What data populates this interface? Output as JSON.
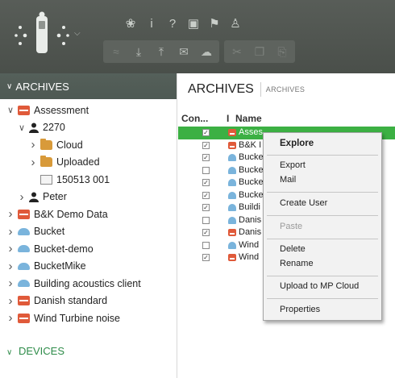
{
  "toolbar": {
    "logo": "meter-logo-icon",
    "row1": [
      {
        "name": "chat-icon",
        "glyph": "❀"
      },
      {
        "name": "info-icon",
        "glyph": "i"
      },
      {
        "name": "help-icon",
        "glyph": "?"
      },
      {
        "name": "report-icon",
        "glyph": "▣"
      },
      {
        "name": "pin-icon",
        "glyph": "⚑"
      },
      {
        "name": "users-icon",
        "glyph": "♙"
      }
    ],
    "row2": [
      {
        "name": "measure-icon",
        "glyph": "≈",
        "disabled": true
      },
      {
        "name": "download-icon",
        "glyph": "⤓",
        "disabled": false
      },
      {
        "name": "upload-icon",
        "glyph": "⤒",
        "disabled": false
      },
      {
        "name": "mail-icon",
        "glyph": "✉",
        "disabled": false
      },
      {
        "name": "cloud-icon",
        "glyph": "☁",
        "disabled": false
      },
      {
        "name": "cut-icon",
        "glyph": "✂",
        "disabled": true
      },
      {
        "name": "copy-icon",
        "glyph": "❐",
        "disabled": true
      },
      {
        "name": "paste-icon",
        "glyph": "⎘",
        "disabled": true
      }
    ]
  },
  "left": {
    "archives_header": "ARCHIVES",
    "devices_header": "DEVICES",
    "tree": [
      {
        "label": "Assessment",
        "icon": "archive",
        "indent": 0,
        "toggle": "expanded"
      },
      {
        "label": "2270",
        "icon": "person",
        "indent": 1,
        "toggle": "expanded"
      },
      {
        "label": "Cloud",
        "icon": "folder",
        "indent": 2,
        "toggle": "collapsed"
      },
      {
        "label": "Uploaded",
        "icon": "folder",
        "indent": 2,
        "toggle": "collapsed"
      },
      {
        "label": "150513 001",
        "icon": "file",
        "indent": 2,
        "toggle": "none"
      },
      {
        "label": "Peter",
        "icon": "person",
        "indent": 1,
        "toggle": "collapsed"
      },
      {
        "label": "B&K Demo Data",
        "icon": "archive",
        "indent": 0,
        "toggle": "collapsed"
      },
      {
        "label": "Bucket",
        "icon": "cloud",
        "indent": 0,
        "toggle": "collapsed"
      },
      {
        "label": "Bucket-demo",
        "icon": "cloud",
        "indent": 0,
        "toggle": "collapsed"
      },
      {
        "label": "BucketMike",
        "icon": "cloud",
        "indent": 0,
        "toggle": "collapsed"
      },
      {
        "label": "Building acoustics client",
        "icon": "cloud",
        "indent": 0,
        "toggle": "collapsed"
      },
      {
        "label": "Danish standard",
        "icon": "archive",
        "indent": 0,
        "toggle": "collapsed"
      },
      {
        "label": "Wind Turbine noise",
        "icon": "archive",
        "indent": 0,
        "toggle": "collapsed"
      }
    ]
  },
  "right": {
    "title": "ARCHIVES",
    "breadcrumb": "ARCHIVES",
    "columns": {
      "con": "Con...",
      "i": "I",
      "name": "Name"
    },
    "rows": [
      {
        "checked": true,
        "icon": "archive",
        "name": "Asses",
        "selected": true
      },
      {
        "checked": true,
        "icon": "archive",
        "name": "B&K I",
        "selected": false
      },
      {
        "checked": true,
        "icon": "cloud",
        "name": "Bucke",
        "selected": false
      },
      {
        "checked": false,
        "icon": "cloud",
        "name": "Bucke",
        "selected": false
      },
      {
        "checked": true,
        "icon": "cloud",
        "name": "Bucke",
        "selected": false
      },
      {
        "checked": true,
        "icon": "cloud",
        "name": "Bucke",
        "selected": false
      },
      {
        "checked": true,
        "icon": "cloud",
        "name": "Buildi",
        "selected": false
      },
      {
        "checked": false,
        "icon": "cloud",
        "name": "Danis",
        "selected": false
      },
      {
        "checked": true,
        "icon": "archive",
        "name": "Danis",
        "selected": false
      },
      {
        "checked": false,
        "icon": "cloud",
        "name": "Wind",
        "selected": false
      },
      {
        "checked": true,
        "icon": "archive",
        "name": "Wind",
        "selected": false
      }
    ]
  },
  "context_menu": {
    "items": [
      {
        "label": "Explore",
        "bold": true,
        "disabled": false
      },
      {
        "label": "Export",
        "bold": false,
        "disabled": false
      },
      {
        "label": "Mail",
        "bold": false,
        "disabled": false
      },
      {
        "label": "Create User",
        "bold": false,
        "disabled": false
      },
      {
        "label": "Paste",
        "bold": false,
        "disabled": true
      },
      {
        "label": "Delete",
        "bold": false,
        "disabled": false
      },
      {
        "label": "Rename",
        "bold": false,
        "disabled": false
      },
      {
        "label": "Upload to MP Cloud",
        "bold": false,
        "disabled": false
      },
      {
        "label": "Properties",
        "bold": false,
        "disabled": false
      }
    ]
  },
  "colors": {
    "toolbar": "#4f544f",
    "header": "#55605a",
    "selection": "#3cb043",
    "archive_icon": "#e05a3a",
    "cloud_icon": "#7ab4dc",
    "folder_icon": "#d89a3a",
    "devices_text": "#2f8c4a"
  }
}
